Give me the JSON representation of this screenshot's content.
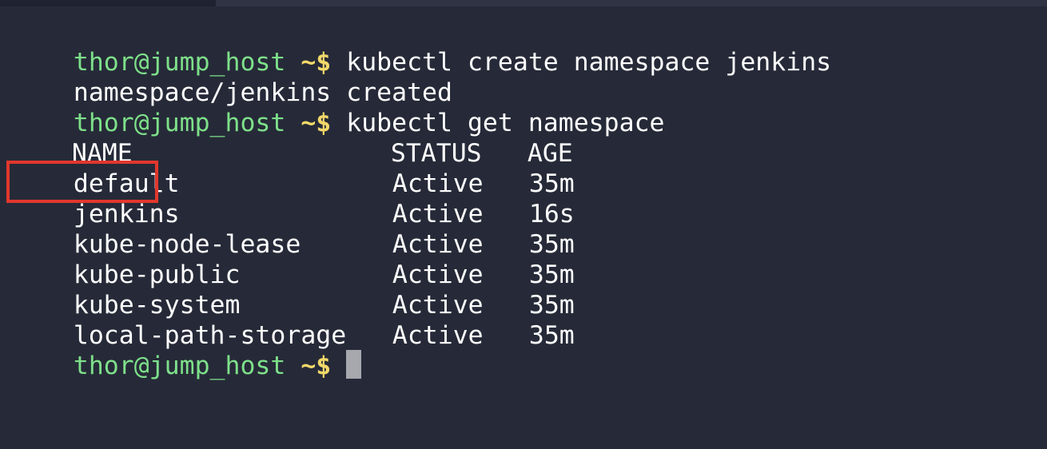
{
  "prompt": {
    "user_host": "thor@jump_host",
    "symbol": "~$"
  },
  "lines": {
    "cmd1": "kubectl create namespace jenkins",
    "out1": "namespace/jenkins created",
    "cmd2": "kubectl get namespace"
  },
  "table": {
    "headers": [
      "NAME",
      "STATUS",
      "AGE"
    ],
    "rows": [
      {
        "name": "default",
        "status": "Active",
        "age": "35m"
      },
      {
        "name": "jenkins",
        "status": "Active",
        "age": "16s"
      },
      {
        "name": "kube-node-lease",
        "status": "Active",
        "age": "35m"
      },
      {
        "name": "kube-public",
        "status": "Active",
        "age": "35m"
      },
      {
        "name": "kube-system",
        "status": "Active",
        "age": "35m"
      },
      {
        "name": "local-path-storage",
        "status": "Active",
        "age": "35m"
      }
    ]
  },
  "highlighted_row": "jenkins",
  "colors": {
    "background": "#262a38",
    "prompt_user": "#7ee08a",
    "prompt_symbol": "#f2d86a",
    "highlight_border": "#e2372d"
  }
}
